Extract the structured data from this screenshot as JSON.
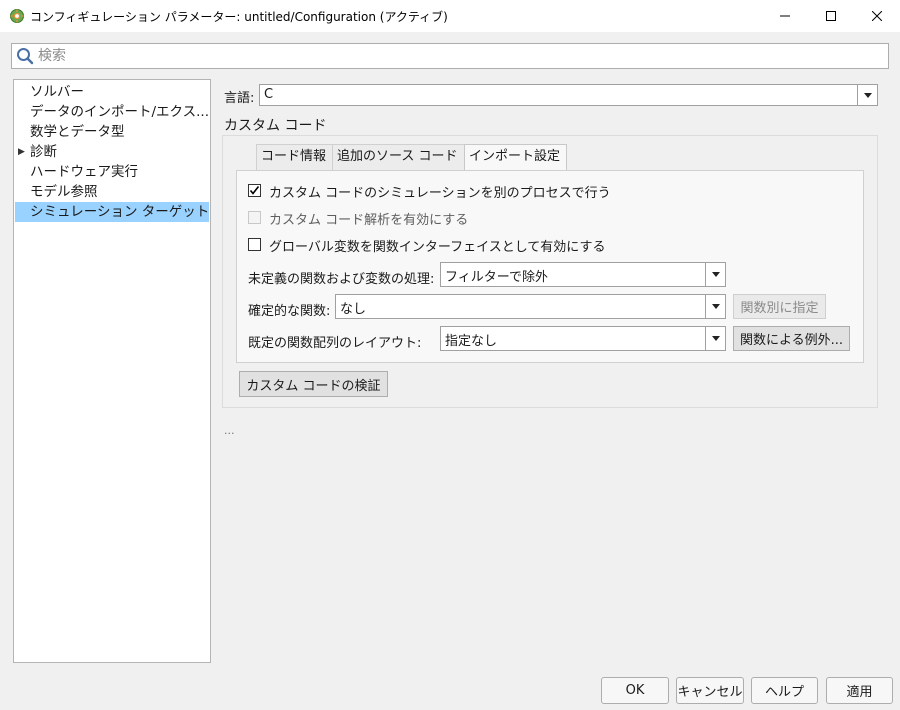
{
  "window": {
    "title": "コンフィギュレーション パラメーター: untitled/Configuration (アクティブ)"
  },
  "search": {
    "placeholder": "検索"
  },
  "sidebar": {
    "items": [
      {
        "label": "ソルバー"
      },
      {
        "label": "データのインポート/エクス..."
      },
      {
        "label": "数学とデータ型"
      },
      {
        "label": "診断"
      },
      {
        "label": "ハードウェア実行"
      },
      {
        "label": "モデル参照"
      },
      {
        "label": "シミュレーション ターゲット",
        "selected": true
      }
    ]
  },
  "language": {
    "label": "言語:",
    "value": "C"
  },
  "custom_code": {
    "heading": "カスタム コード",
    "tabs": [
      {
        "label": "コード情報"
      },
      {
        "label": "追加のソース コード"
      },
      {
        "label": "インポート設定",
        "active": true
      }
    ],
    "checkboxes": [
      {
        "label": "カスタム コードのシミュレーションを別のプロセスで行う",
        "checked": true,
        "enabled": true
      },
      {
        "label": "カスタム コード解析を有効にする",
        "checked": false,
        "enabled": false
      },
      {
        "label": "グローバル変数を関数インターフェイスとして有効にする",
        "checked": false,
        "enabled": true
      }
    ],
    "undefined_handling": {
      "label": "未定義の関数および変数の処理:",
      "value": "フィルターで除外"
    },
    "deterministic_functions": {
      "label": "確定的な関数:",
      "value": "なし",
      "button": "関数別に指定"
    },
    "array_layout": {
      "label": "既定の関数配列のレイアウト:",
      "value": "指定なし",
      "button": "関数による例外..."
    },
    "validate_button": "カスタム コードの検証"
  },
  "ellipsis": "...",
  "footer": {
    "ok": "OK",
    "cancel": "キャンセル",
    "help": "ヘルプ",
    "apply": "適用"
  }
}
